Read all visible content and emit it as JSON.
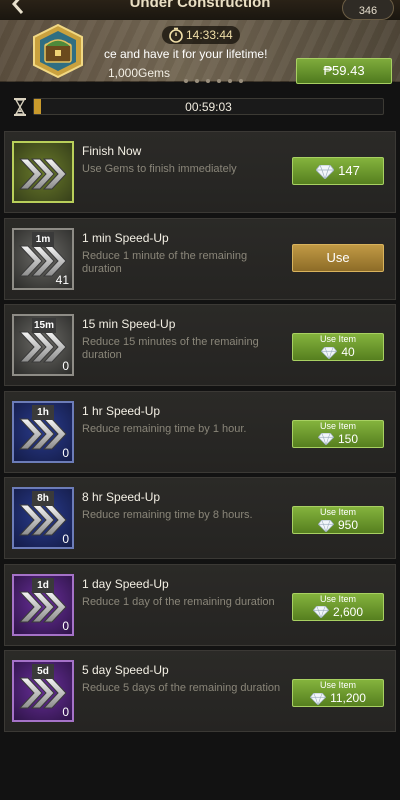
{
  "header": {
    "title": "Under Construction",
    "gem_count": "346"
  },
  "promo": {
    "timer": "14:33:44",
    "text": "ce and have it for your lifetime!",
    "gems": "1,000Gems",
    "price": "₱59.43"
  },
  "progress": {
    "time": "00:59:03",
    "fill_fraction": 0.02
  },
  "items": [
    {
      "title": "Finish Now",
      "desc": "Use Gems to finish immediately",
      "badge": "",
      "count": "",
      "button_type": "gems",
      "button_label": "",
      "button_value": "147",
      "tier": "green"
    },
    {
      "title": "1 min Speed-Up",
      "desc": "Reduce 1 minute of the remaining duration",
      "badge": "1m",
      "count": "41",
      "button_type": "use",
      "button_label": "Use",
      "button_value": "",
      "tier": "gray"
    },
    {
      "title": "15 min Speed-Up",
      "desc": "Reduce 15 minutes of the remaining duration",
      "badge": "15m",
      "count": "0",
      "button_type": "useitem",
      "button_label": "Use Item",
      "button_value": "40",
      "tier": "gray"
    },
    {
      "title": "1 hr Speed-Up",
      "desc": "Reduce remaining time by 1 hour.",
      "badge": "1h",
      "count": "0",
      "button_type": "useitem",
      "button_label": "Use Item",
      "button_value": "150",
      "tier": "blue"
    },
    {
      "title": "8 hr Speed-Up",
      "desc": "Reduce remaining time by 8 hours.",
      "badge": "8h",
      "count": "0",
      "button_type": "useitem",
      "button_label": "Use Item",
      "button_value": "950",
      "tier": "blue"
    },
    {
      "title": "1 day Speed-Up",
      "desc": "Reduce 1 day of the remaining duration",
      "badge": "1d",
      "count": "0",
      "button_type": "useitem",
      "button_label": "Use Item",
      "button_value": "2,600",
      "tier": "purple"
    },
    {
      "title": "5 day Speed-Up",
      "desc": "Reduce 5 days of the remaining duration",
      "badge": "5d",
      "count": "0",
      "button_type": "useitem",
      "button_label": "Use Item",
      "button_value": "11,200",
      "tier": "purple"
    }
  ],
  "icons": {
    "back": "back-arrow-icon",
    "gem": "diamond-gem-icon",
    "clock": "stopwatch-icon",
    "hourglass": "hourglass-icon",
    "chest": "treasure-chest-icon",
    "speedup": "speed-up-chevrons-icon"
  },
  "colors": {
    "button_green": "#6f9a2e",
    "button_gold": "#a8832f",
    "progress_fill": "#c99a2c"
  }
}
